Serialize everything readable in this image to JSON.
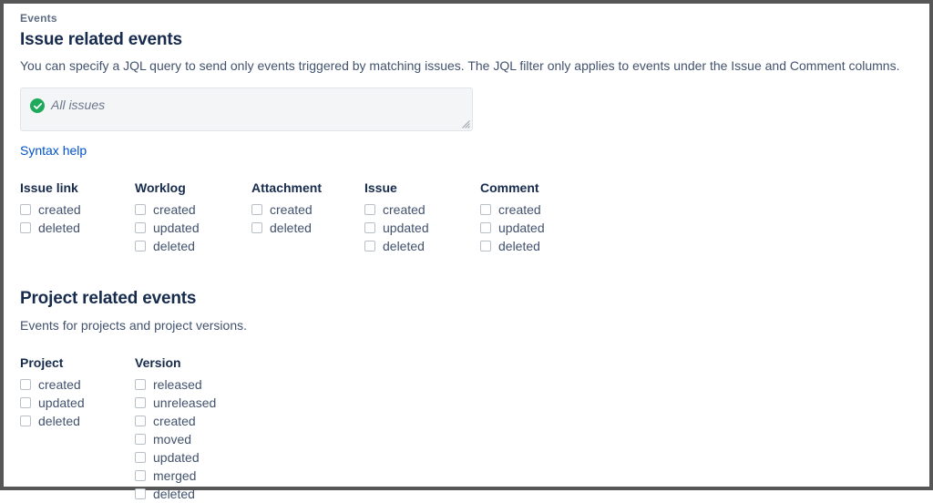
{
  "eyebrow": "Events",
  "issue_section": {
    "heading": "Issue related events",
    "description": "You can specify a JQL query to send only events triggered by matching issues. The JQL filter only applies to events under the Issue and Comment columns.",
    "jql": {
      "value": "All issues",
      "placeholder": "All issues",
      "status_icon": "check-circle-icon",
      "status_color": "#1FA95A"
    },
    "syntax_help_label": "Syntax help",
    "columns": [
      {
        "header": "Issue link",
        "options": [
          "created",
          "deleted"
        ]
      },
      {
        "header": "Worklog",
        "options": [
          "created",
          "updated",
          "deleted"
        ]
      },
      {
        "header": "Attachment",
        "options": [
          "created",
          "deleted"
        ]
      },
      {
        "header": "Issue",
        "options": [
          "created",
          "updated",
          "deleted"
        ]
      },
      {
        "header": "Comment",
        "options": [
          "created",
          "updated",
          "deleted"
        ]
      }
    ]
  },
  "project_section": {
    "heading": "Project related events",
    "description": "Events for projects and project versions.",
    "columns": [
      {
        "header": "Project",
        "options": [
          "created",
          "updated",
          "deleted"
        ]
      },
      {
        "header": "Version",
        "options": [
          "released",
          "unreleased",
          "created",
          "moved",
          "updated",
          "merged",
          "deleted"
        ]
      }
    ]
  },
  "colors": {
    "heading": "#172B4D",
    "body_text": "#42526E",
    "link": "#0052CC",
    "eyebrow": "#5E6C84",
    "field_bg": "#F4F5F7",
    "frame": "#575757"
  }
}
